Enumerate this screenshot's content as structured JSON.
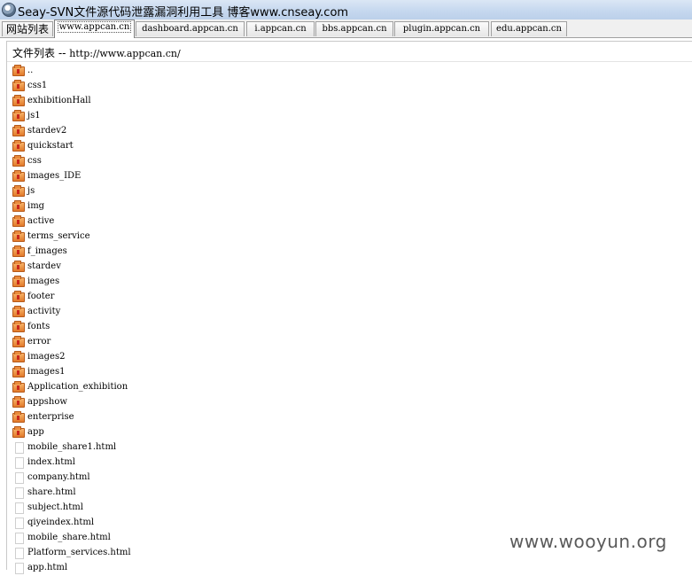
{
  "window": {
    "title": "Seay-SVN文件源代码泄露漏洞利用工具  博客www.cnseay.com"
  },
  "tabs": [
    {
      "label": "网站列表",
      "active": false
    },
    {
      "label": "www.appcan.cn",
      "active": true
    },
    {
      "label": "dashboard.appcan.cn",
      "active": false
    },
    {
      "label": "i.appcan.cn",
      "active": false
    },
    {
      "label": "bbs.appcan.cn",
      "active": false
    },
    {
      "label": "plugin.appcan.cn",
      "active": false
    },
    {
      "label": "edu.appcan.cn",
      "active": false
    }
  ],
  "list": {
    "header_label": "文件列表 -- ",
    "header_url": "http://www.appcan.cn/",
    "items": [
      {
        "name": "..",
        "type": "folder"
      },
      {
        "name": "css1",
        "type": "folder"
      },
      {
        "name": "exhibitionHall",
        "type": "folder"
      },
      {
        "name": "js1",
        "type": "folder"
      },
      {
        "name": "stardev2",
        "type": "folder"
      },
      {
        "name": "quickstart",
        "type": "folder"
      },
      {
        "name": "css",
        "type": "folder"
      },
      {
        "name": "images_IDE",
        "type": "folder"
      },
      {
        "name": "js",
        "type": "folder"
      },
      {
        "name": "img",
        "type": "folder"
      },
      {
        "name": "active",
        "type": "folder"
      },
      {
        "name": "terms_service",
        "type": "folder"
      },
      {
        "name": "f_images",
        "type": "folder"
      },
      {
        "name": "stardev",
        "type": "folder"
      },
      {
        "name": "images",
        "type": "folder"
      },
      {
        "name": "footer",
        "type": "folder"
      },
      {
        "name": "activity",
        "type": "folder"
      },
      {
        "name": "fonts",
        "type": "folder"
      },
      {
        "name": "error",
        "type": "folder"
      },
      {
        "name": "images2",
        "type": "folder"
      },
      {
        "name": "images1",
        "type": "folder"
      },
      {
        "name": "Application_exhibition",
        "type": "folder"
      },
      {
        "name": "appshow",
        "type": "folder"
      },
      {
        "name": "enterprise",
        "type": "folder"
      },
      {
        "name": "app",
        "type": "folder"
      },
      {
        "name": "mobile_share1.html",
        "type": "file"
      },
      {
        "name": "index.html",
        "type": "file"
      },
      {
        "name": "company.html",
        "type": "file"
      },
      {
        "name": "share.html",
        "type": "file"
      },
      {
        "name": "subject.html",
        "type": "file"
      },
      {
        "name": "qiyeindex.html",
        "type": "file"
      },
      {
        "name": "mobile_share.html",
        "type": "file"
      },
      {
        "name": "Platform_services.html",
        "type": "file"
      },
      {
        "name": "app.html",
        "type": "file"
      }
    ]
  },
  "watermark": "www.wooyun.org"
}
